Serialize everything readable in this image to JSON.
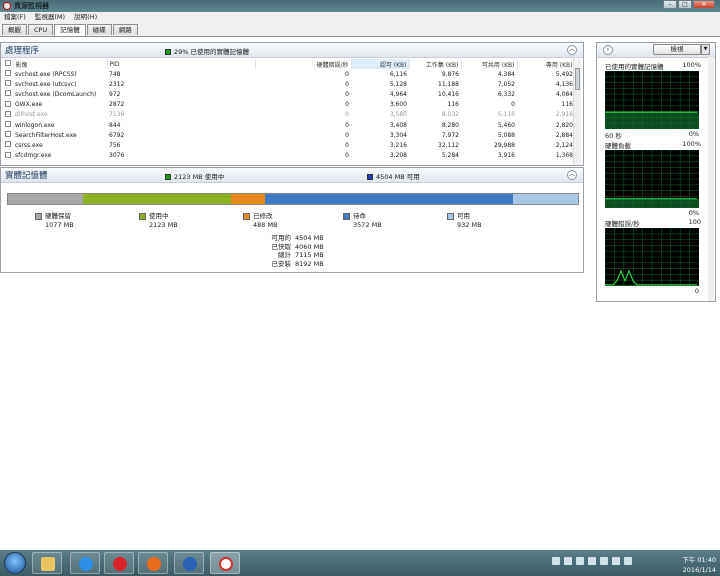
{
  "window": {
    "title": "資源監視器",
    "minimize": "–",
    "maximize": "□",
    "close": "✕"
  },
  "menu": [
    "檔案(F)",
    "監視器(M)",
    "說明(H)"
  ],
  "tabs": [
    {
      "label": "概觀",
      "active": false
    },
    {
      "label": "CPU",
      "active": false
    },
    {
      "label": "記憶體",
      "active": true
    },
    {
      "label": "磁碟",
      "active": false
    },
    {
      "label": "網路",
      "active": false
    }
  ],
  "processes": {
    "title": "處理程序",
    "summary": "29% 已使用的實體記憶體",
    "summary_color": "#13a10e",
    "columns": [
      "影像",
      "PID",
      "硬體錯誤/秒",
      "認可 (KB)",
      "工作集 (KB)",
      "可共用 (KB)",
      "專用 (KB)"
    ],
    "rows": [
      {
        "name": "svchost.exe (RPCSS)",
        "pid": "748",
        "faults": "0",
        "commit": "6,116",
        "ws": "9,876",
        "share": "4,384",
        "priv": "5,492",
        "dim": false
      },
      {
        "name": "svchost.exe (utcsvc)",
        "pid": "2312",
        "faults": "0",
        "commit": "5,128",
        "ws": "11,188",
        "share": "7,052",
        "priv": "4,136",
        "dim": false
      },
      {
        "name": "svchost.exe (DcomLaunch)",
        "pid": "972",
        "faults": "0",
        "commit": "4,964",
        "ws": "10,416",
        "share": "6,332",
        "priv": "4,084",
        "dim": false
      },
      {
        "name": "GWX.exe",
        "pid": "2872",
        "faults": "0",
        "commit": "3,600",
        "ws": "116",
        "share": "0",
        "priv": "116",
        "dim": false
      },
      {
        "name": "dllhost.exe",
        "pid": "7136",
        "faults": "0",
        "commit": "3,580",
        "ws": "8,032",
        "share": "5,116",
        "priv": "2,916",
        "dim": true
      },
      {
        "name": "winlogon.exe",
        "pid": "844",
        "faults": "0",
        "commit": "3,408",
        "ws": "8,280",
        "share": "5,460",
        "priv": "2,820",
        "dim": false
      },
      {
        "name": "SearchFilterHost.exe",
        "pid": "6792",
        "faults": "0",
        "commit": "3,304",
        "ws": "7,972",
        "share": "5,088",
        "priv": "2,884",
        "dim": false
      },
      {
        "name": "csrss.exe",
        "pid": "756",
        "faults": "0",
        "commit": "3,216",
        "ws": "32,112",
        "share": "29,988",
        "priv": "2,124",
        "dim": false
      },
      {
        "name": "sfcdmgr.exe",
        "pid": "3076",
        "faults": "0",
        "commit": "3,208",
        "ws": "5,284",
        "share": "3,916",
        "priv": "1,368",
        "dim": false
      }
    ]
  },
  "memory": {
    "title": "實體記憶體",
    "inuse_caption": "2123 MB 使用中",
    "available_caption": "4504 MB 可用",
    "colors": {
      "reserved": "#a9a9a9",
      "inuse": "#8db325",
      "modified": "#e6891a",
      "standby": "#3e7bc4",
      "free": "#a8c8e8"
    },
    "legend": [
      {
        "key": "reserved",
        "label": "硬體保留",
        "value": "1077 MB",
        "mb": 1077
      },
      {
        "key": "inuse",
        "label": "使用中",
        "value": "2123 MB",
        "mb": 2123
      },
      {
        "key": "modified",
        "label": "已修改",
        "value": "488 MB",
        "mb": 488
      },
      {
        "key": "standby",
        "label": "待命",
        "value": "3572 MB",
        "mb": 3572
      },
      {
        "key": "free",
        "label": "可用",
        "value": "932 MB",
        "mb": 932
      }
    ],
    "totals": [
      {
        "label": "可用的",
        "value": "4504 MB"
      },
      {
        "label": "已快取",
        "value": "4060 MB"
      },
      {
        "label": "總計",
        "value": "7115 MB"
      },
      {
        "label": "已安裝",
        "value": "8192 MB"
      }
    ]
  },
  "side": {
    "view_label": "檢視",
    "graphs": [
      {
        "title": "已使用的實體記憶體",
        "top": "100%",
        "foot_left": "60 秒",
        "foot_right": "0%",
        "level": 0.29
      },
      {
        "title": "硬體負載",
        "top": "100%",
        "foot_left": "",
        "foot_right": "0%",
        "level": 0.16
      },
      {
        "title": "硬體錯誤/秒",
        "top": "100",
        "foot_left": "",
        "foot_right": "0",
        "level": 0.02
      }
    ]
  },
  "taskbar": {
    "apps": [
      "explorer",
      "ie",
      "opera",
      "firefox",
      "firefox2",
      "resmon"
    ],
    "time": "下午 01:40",
    "date": "2016/1/14"
  }
}
